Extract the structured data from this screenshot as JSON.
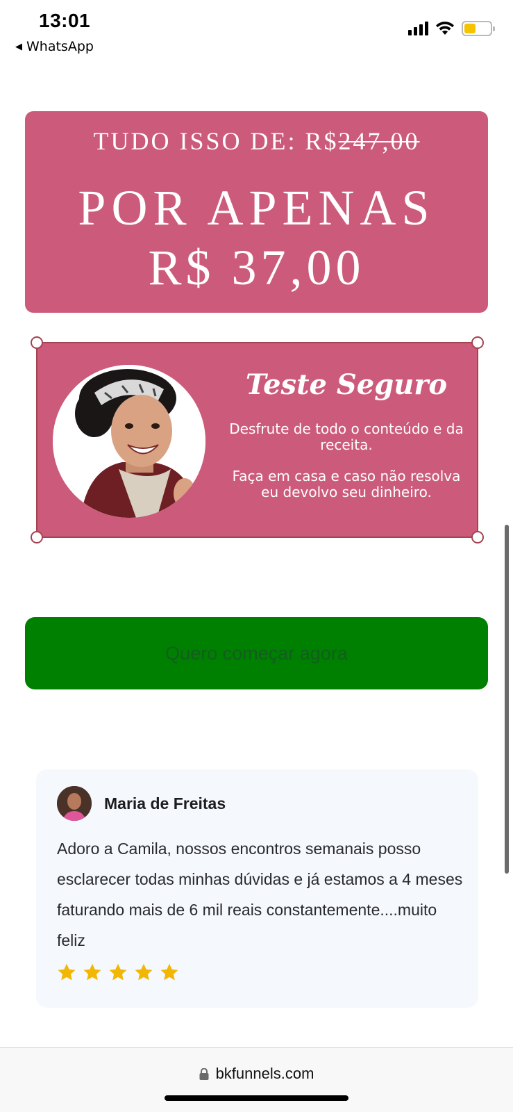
{
  "status_bar": {
    "time": "13:01",
    "back_label": "WhatsApp",
    "icons": [
      "signal-icon",
      "wifi-icon",
      "battery-icon"
    ],
    "battery_color": "#f5c400"
  },
  "price_box": {
    "line1_prefix": "TUDO ISSO DE: R$",
    "old_price": "247,00",
    "line2": "POR APENAS",
    "line3": "R$ 37,00",
    "bg_color": "#cc5b7b"
  },
  "guarantee": {
    "title": "Teste Seguro",
    "text1": "Desfrute de todo o conteúdo e da receita.",
    "text2": "Faça em casa e caso não resolva eu devolvo seu dinheiro."
  },
  "cta": {
    "label": "Quero começar agora",
    "bg_color": "#008000"
  },
  "testimonial": {
    "name": "Maria de Freitas",
    "text": "Adoro a Camila, nossos encontros semanais posso esclarecer todas minhas dúvidas e já estamos a 4 meses faturando mais de 6 mil reais constantemente....muito feliz",
    "rating": 5,
    "star_color": "#f2b705"
  },
  "browser": {
    "url": "bkfunnels.com"
  }
}
